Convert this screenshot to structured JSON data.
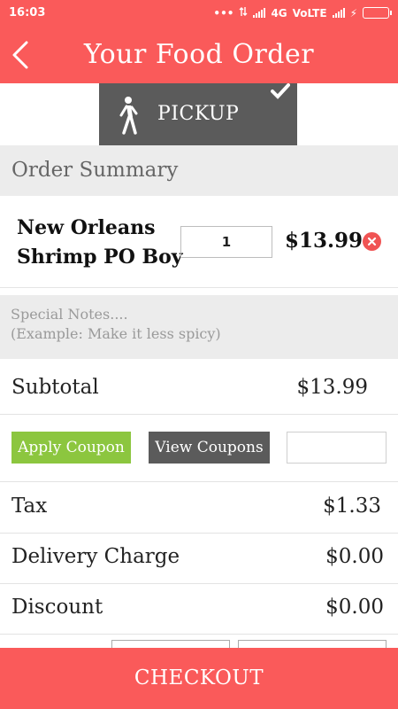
{
  "status_bar": {
    "time": "16:03",
    "dots": "•••",
    "network": "4G",
    "carrier": "VoLTE",
    "bolt": "⚡"
  },
  "header": {
    "title": "Your Food Order",
    "back_icon": "chevron-left-icon"
  },
  "pickup": {
    "label": "PICKUP",
    "selected": true,
    "icon": "walking-person-icon"
  },
  "order_summary": {
    "title": "Order Summary"
  },
  "items": [
    {
      "name": "New Orleans Shrimp PO Boy",
      "quantity": "1",
      "price": "$13.99"
    }
  ],
  "notes": {
    "placeholder": "Special Notes....\n(Example: Make it less spicy)"
  },
  "subtotal": {
    "label": "Subtotal",
    "value": "$13.99"
  },
  "coupon": {
    "apply_label": "Apply Coupon",
    "view_label": "View Coupons",
    "code_value": ""
  },
  "tax": {
    "label": "Tax",
    "value": "$1.33"
  },
  "delivery": {
    "label": "Delivery Charge",
    "value": "$0.00"
  },
  "discount": {
    "label": "Discount",
    "value": "$0.00"
  },
  "checkout": {
    "label": "CHECKOUT"
  },
  "colors": {
    "primary": "#fa5a5a",
    "dark": "#5b5b5b",
    "apply_green": "#8cc63f",
    "remove_red": "#f05454",
    "battery": "#49d14a"
  }
}
